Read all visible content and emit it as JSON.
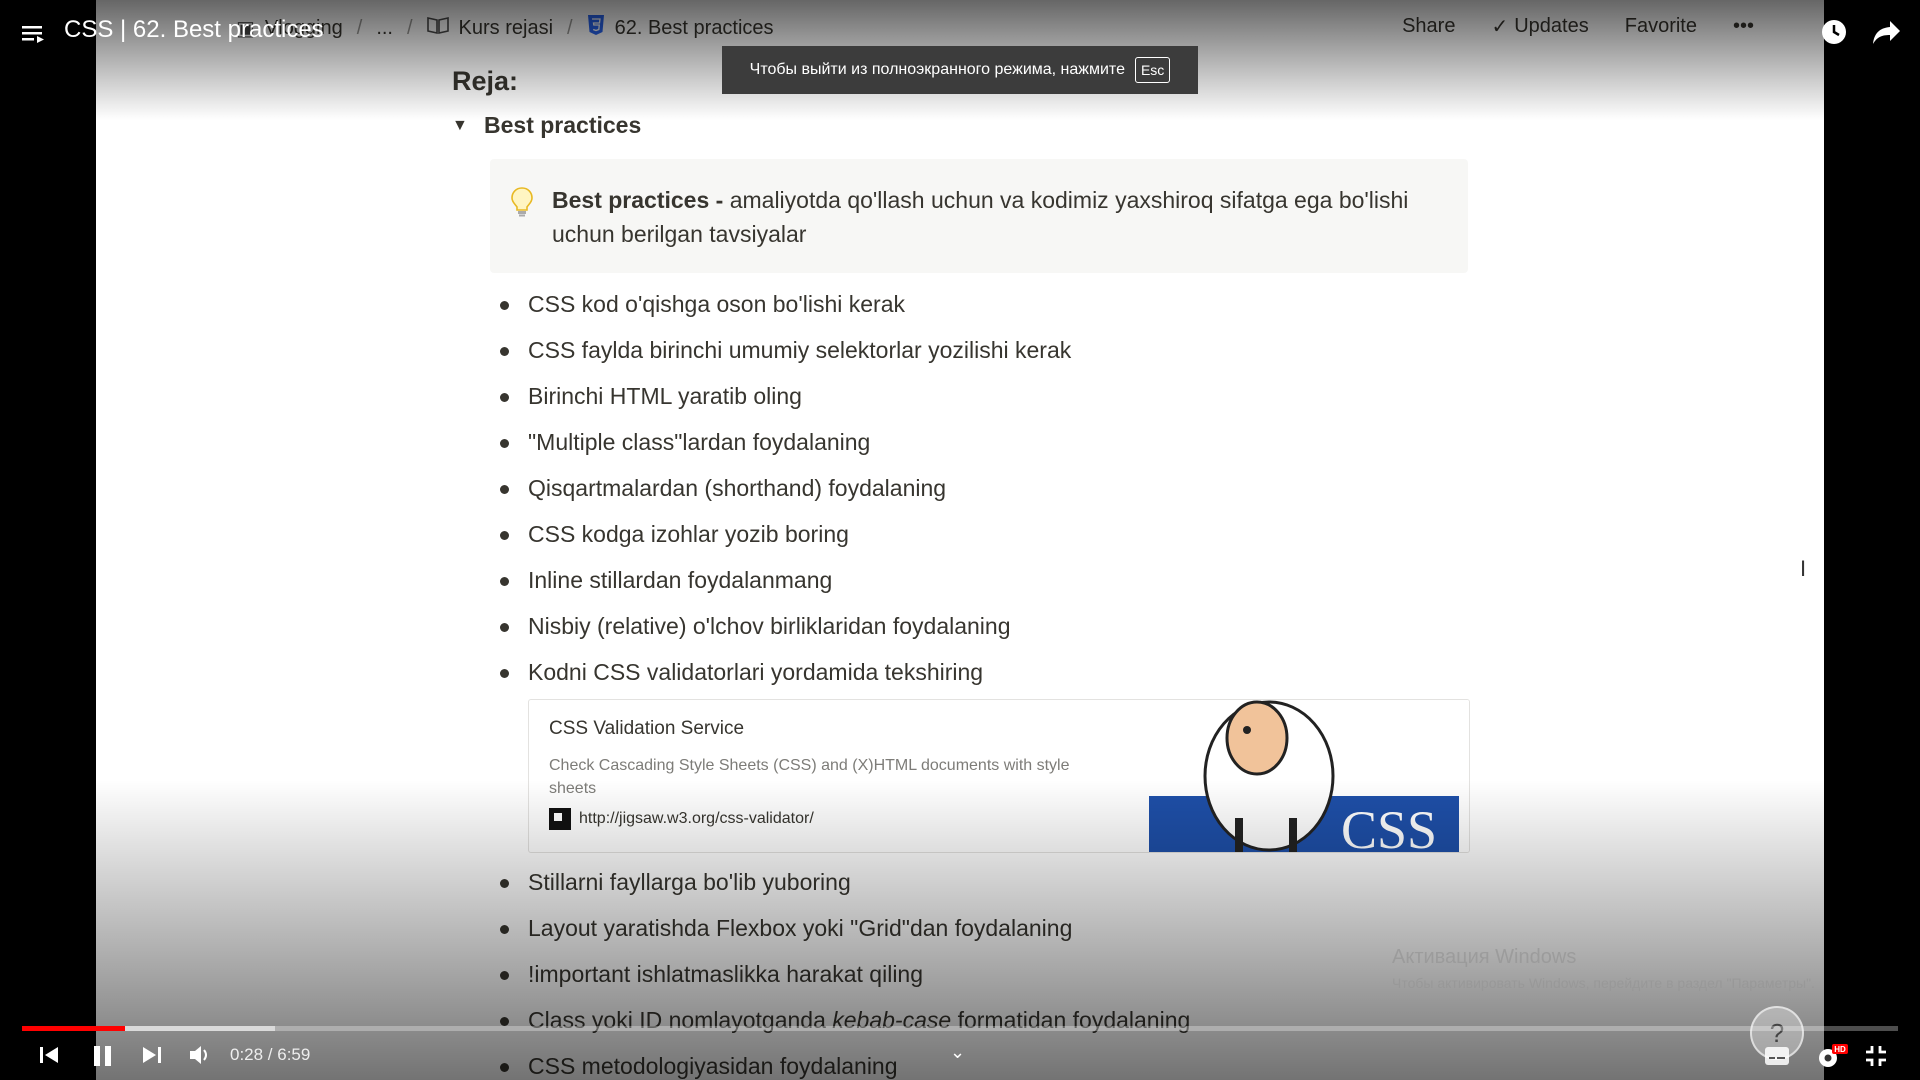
{
  "video_title": "CSS | 62. Best practices",
  "breadcrumbs": [
    "Vlogging",
    "...",
    "Kurs rejasi",
    "62. Best practices"
  ],
  "top_actions": {
    "share": "Share",
    "updates": "Updates",
    "favorite": "Favorite",
    "more": "•••"
  },
  "fullscreen_toast": {
    "text": "Чтобы выйти из полноэкранного режима, нажмите",
    "key": "Esc"
  },
  "page": {
    "heading": "Reja:",
    "toggle_label": "Best practices",
    "callout": {
      "bold": "Best practices -",
      "text": " amaliyotda qo'llash uchun va kodimiz yaxshiroq sifatga ega bo'lishi uchun berilgan tavsiyalar"
    },
    "items_before": [
      "CSS kod o'qishga oson bo'lishi kerak",
      "CSS faylda birinchi umumiy selektorlar yozilishi kerak",
      "Birinchi HTML yaratib oling",
      "\"Multiple class\"lardan foydalaning",
      "Qisqartmalardan (shorthand) foydalaning",
      "CSS kodga izohlar yozib boring",
      "Inline stillardan foydalanmang",
      "Nisbiy (relative) o'lchov birliklaridan foydalaning",
      "Kodni CSS validatorlari yordamida tekshiring"
    ],
    "bookmark": {
      "title": "CSS Validation Service",
      "description": "Check Cascading Style Sheets (CSS) and (X)HTML documents with style sheets",
      "url": "http://jigsaw.w3.org/css-validator/",
      "image_text": "CSS"
    },
    "items_after": [
      "Stillarni fayllarga bo'lib yuboring",
      "Layout yaratishda Flexbox yoki \"Grid\"dan foydalaning",
      "!important ishlatmaslikka harakat qiling"
    ],
    "item_kebab": {
      "pre": "Class yoki ID nomlayotganda ",
      "italic": "kebab-case",
      "post": " formatidan foydalaning"
    },
    "item_last": "CSS metodologiyasidan foydalaning"
  },
  "activation": {
    "title": "Активация Windows",
    "subtitle": "Чтобы активировать Windows, перейдите в раздел \"Параметры\"."
  },
  "player": {
    "time": "0:28 / 6:59",
    "played_fraction": 0.055,
    "buffered_fraction": 0.135,
    "quality_badge": "HD",
    "help": "?"
  },
  "colors": {
    "progress": "#ff0000",
    "text": "#37352f",
    "callout_bg": "#f7f7f5"
  }
}
